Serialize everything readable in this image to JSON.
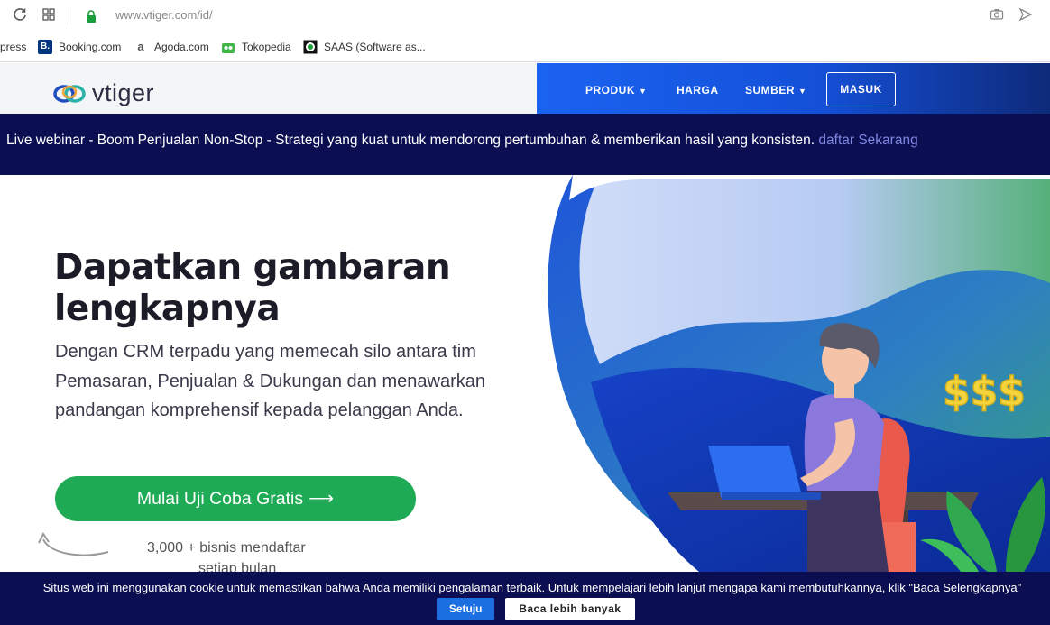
{
  "browser": {
    "url": "www.vtiger.com/id/",
    "bookmarks": [
      {
        "label": "xpress",
        "icon": "express-favicon"
      },
      {
        "label": "Booking.com",
        "icon": "booking-favicon"
      },
      {
        "label": "Agoda.com",
        "icon": "agoda-favicon"
      },
      {
        "label": "Tokopedia",
        "icon": "tokopedia-favicon"
      },
      {
        "label": "SAAS (Software as...",
        "icon": "saas-favicon"
      }
    ]
  },
  "header": {
    "logo_text": "vtiger",
    "nav": {
      "produk": "PRODUK",
      "harga": "HARGA",
      "sumber": "SUMBER",
      "masuk": "MASUK"
    },
    "colors": {
      "nav_start": "#1a63f0",
      "nav_end": "#0e2a7a"
    }
  },
  "banner": {
    "text": "Live webinar - Boom Penjualan Non-Stop - Strategi yang kuat untuk mendorong pertumbuhan & memberikan hasil yang konsisten.",
    "link": "daftar Sekarang"
  },
  "hero": {
    "title": "Dapatkan gambaran lengkapnya",
    "description": "Dengan CRM terpadu yang memecah silo antara tim Pemasaran, Penjualan & Dukungan dan menawarkan pandangan komprehensif kepada pelanggan Anda.",
    "cta": "Mulai Uji Coba Gratis",
    "cta_arrow": "⟶",
    "signup_count": "3,000 + bisnis mendaftar",
    "signup_suffix": "setiap bulan",
    "accent": "#1fab55"
  },
  "cookie": {
    "text": "Situs web ini menggunakan cookie untuk memastikan bahwa Anda memiliki pengalaman terbaik. Untuk mempelajari lebih lanjut mengapa kami membutuhkannya, klik \"Baca Selengkapnya\"",
    "accept": "Setuju",
    "more": "Baca lebih banyak"
  }
}
